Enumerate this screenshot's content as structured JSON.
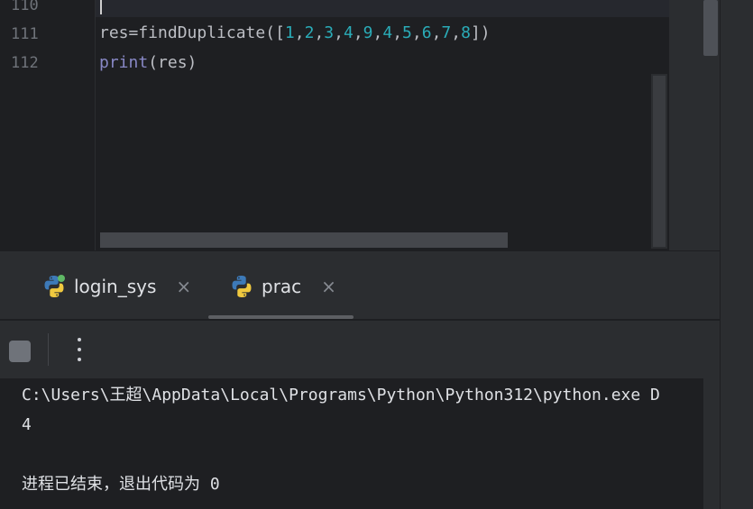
{
  "editor": {
    "lines": [
      {
        "number": "110",
        "tokens": []
      },
      {
        "number": "111",
        "tokens": [
          {
            "text": "res=findDuplicate([",
            "kind": "plain"
          },
          {
            "text": "1",
            "kind": "num"
          },
          {
            "text": ",",
            "kind": "plain"
          },
          {
            "text": "2",
            "kind": "num"
          },
          {
            "text": ",",
            "kind": "plain"
          },
          {
            "text": "3",
            "kind": "num"
          },
          {
            "text": ",",
            "kind": "plain"
          },
          {
            "text": "4",
            "kind": "num"
          },
          {
            "text": ",",
            "kind": "plain"
          },
          {
            "text": "9",
            "kind": "num"
          },
          {
            "text": ",",
            "kind": "plain"
          },
          {
            "text": "4",
            "kind": "num"
          },
          {
            "text": ",",
            "kind": "plain"
          },
          {
            "text": "5",
            "kind": "num"
          },
          {
            "text": ",",
            "kind": "plain"
          },
          {
            "text": "6",
            "kind": "num"
          },
          {
            "text": ",",
            "kind": "plain"
          },
          {
            "text": "7",
            "kind": "num"
          },
          {
            "text": ",",
            "kind": "plain"
          },
          {
            "text": "8",
            "kind": "num"
          },
          {
            "text": "])",
            "kind": "plain"
          }
        ]
      },
      {
        "number": "112",
        "tokens": [
          {
            "text": "print",
            "kind": "builtin"
          },
          {
            "text": "(res)",
            "kind": "plain"
          }
        ]
      }
    ]
  },
  "run_panel": {
    "tabs": [
      {
        "label": "login_sys",
        "icon": "python-icon",
        "close": "×"
      },
      {
        "label": "prac",
        "icon": "python-icon",
        "close": "×"
      }
    ],
    "active_tab": "prac",
    "toolbar": {
      "stop_icon": "stop-icon",
      "more_icon": "more-vertical-icon"
    },
    "console": {
      "lines": [
        "C:\\Users\\王超\\AppData\\Local\\Programs\\Python\\Python312\\python.exe D",
        "4",
        "",
        "进程已结束，退出代码为 0"
      ]
    }
  },
  "colors": {
    "background": "#1e1f22",
    "panel": "#2b2d30",
    "number_token": "#2aacb8",
    "builtin_token": "#8888c6",
    "text": "#bcbec4",
    "python_blue": "#3d7ab8",
    "python_yellow": "#f0c93f",
    "status_green": "#5fb865"
  }
}
